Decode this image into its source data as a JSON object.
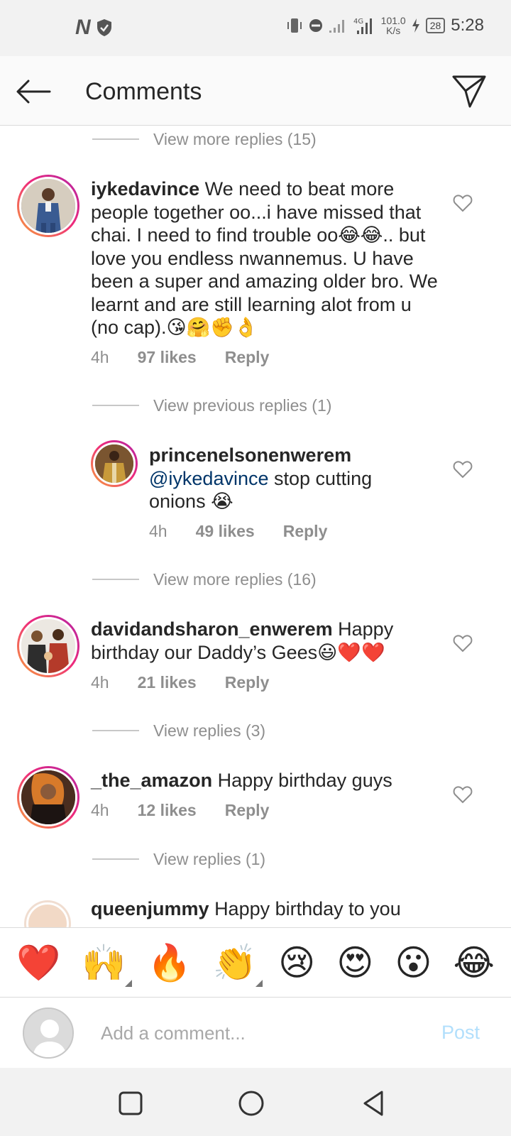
{
  "status_bar": {
    "app_letter": "N",
    "speed_value": "101.0",
    "speed_unit": "K/s",
    "network": "4G",
    "battery": "28",
    "time": "5:28"
  },
  "header": {
    "title": "Comments"
  },
  "feed": {
    "view_more_top": "View more replies (15)",
    "comments": [
      {
        "username": "iykedavince",
        "text": "We need to beat more people together oo...i have missed that chai. I need to find trouble oo😂😂.. but love you endless nwannemus. U have been a super and amazing older bro. We learnt and are still learning alot from u (no cap).😘🤗✊👌",
        "time": "4h",
        "likes": "97 likes",
        "reply": "Reply"
      },
      {
        "username": "davidandsharon_enwerem",
        "text": "Happy birthday our Daddy’s Gees😃❤️❤️",
        "time": "4h",
        "likes": "21 likes",
        "reply": "Reply"
      },
      {
        "username": "_the_amazon",
        "text": "Happy birthday guys",
        "time": "4h",
        "likes": "12 likes",
        "reply": "Reply"
      },
      {
        "username": "queenjummy",
        "text": "Happy birthday to you"
      }
    ],
    "view_previous_1": "View previous replies (1)",
    "reply_1": {
      "username": "princenelsonenwerem",
      "mention": "@iykedavince",
      "text": "stop cutting onions 😭",
      "time": "4h",
      "likes": "49 likes",
      "reply": "Reply"
    },
    "view_more_1": "View more replies (16)",
    "view_replies_2": "View replies (3)",
    "view_replies_3": "View replies (1)"
  },
  "emoji_bar": [
    "❤️",
    "🙌",
    "🔥",
    "👏",
    "😢",
    "😍",
    "😮",
    "😂"
  ],
  "input": {
    "placeholder": "Add a comment...",
    "post_label": "Post"
  },
  "colors": {
    "link_mention": "#003569",
    "post_disabled": "#b2dffc",
    "secondary_text": "#8e8e8e"
  }
}
